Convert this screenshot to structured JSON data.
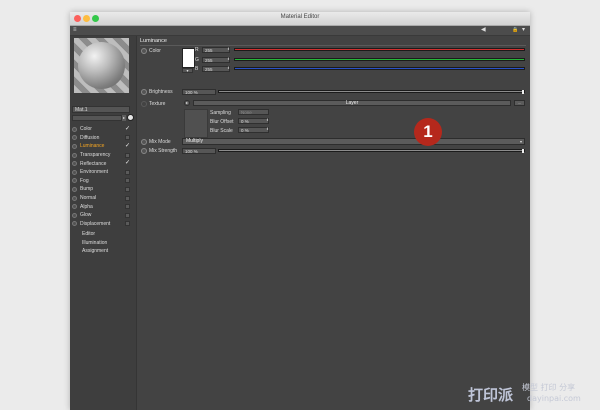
{
  "window": {
    "title": "Material Editor",
    "traffic_colors": [
      "#fc605c",
      "#fdbc40",
      "#34c84a"
    ]
  },
  "toolbar": {
    "left_icon": "≡",
    "back_icon": "◀",
    "lock_icon": "🔒",
    "menu_icon": "▾"
  },
  "sidebar": {
    "material_name": "Mat.1",
    "channels": [
      {
        "label": "Color",
        "checked": true
      },
      {
        "label": "Diffusion",
        "checked": false
      },
      {
        "label": "Luminance",
        "checked": true,
        "active": true
      },
      {
        "label": "Transparency",
        "checked": false
      },
      {
        "label": "Reflectance",
        "checked": true
      },
      {
        "label": "Environment",
        "checked": false
      },
      {
        "label": "Fog",
        "checked": false
      },
      {
        "label": "Bump",
        "checked": false
      },
      {
        "label": "Normal",
        "checked": false
      },
      {
        "label": "Alpha",
        "checked": false
      },
      {
        "label": "Glow",
        "checked": false
      },
      {
        "label": "Displacement",
        "checked": false
      }
    ],
    "subpages": [
      "Editor",
      "Illumination",
      "Assignment"
    ]
  },
  "luminance": {
    "section_title": "Luminance",
    "color_label": "Color",
    "color_hex": "#ffffff",
    "rgb": [
      {
        "label": "R",
        "value": "255",
        "color": "#d03030"
      },
      {
        "label": "G",
        "value": "255",
        "color": "#27b53a"
      },
      {
        "label": "B",
        "value": "255",
        "color": "#2a52c8"
      }
    ],
    "brightness_label": "Brightness",
    "brightness_value": "100 %",
    "brightness_pct": 100,
    "texture_label": "Texture",
    "texture_button": "Layer",
    "sampling_label": "Sampling",
    "sampling_value": "None",
    "blur_offset_label": "Blur Offset",
    "blur_offset_value": "0 %",
    "blur_scale_label": "Blur Scale",
    "blur_scale_value": "0 %",
    "mix_mode_label": "Mix Mode",
    "mix_mode_value": "Multiply",
    "mix_strength_label": "Mix Strength",
    "mix_strength_value": "100 %",
    "mix_strength_pct": 100
  },
  "callout": "1",
  "watermark": {
    "logo": "打印派",
    "sub_top": "模型 打印 分享",
    "sub_bottom": "dayinpai.com"
  }
}
